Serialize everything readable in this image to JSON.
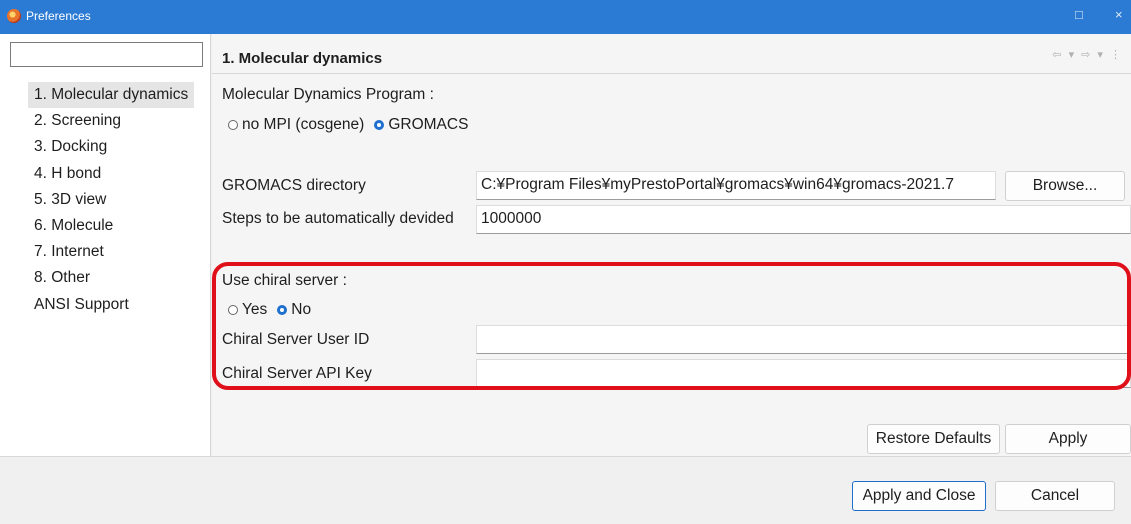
{
  "window": {
    "title": "Preferences",
    "controls": {
      "maximize": "□",
      "close": "×"
    }
  },
  "sidebar": {
    "filter_value": "",
    "items": [
      {
        "label": "1. Molecular dynamics",
        "selected": true
      },
      {
        "label": "2. Screening"
      },
      {
        "label": "3. Docking"
      },
      {
        "label": "4. H bond"
      },
      {
        "label": "5. 3D view"
      },
      {
        "label": "6. Molecule"
      },
      {
        "label": "7. Internet"
      },
      {
        "label": "8. Other"
      },
      {
        "label": "ANSI Support"
      }
    ]
  },
  "page": {
    "title": "1. Molecular dynamics",
    "nav_arrows": "⇦ ▾ ⇨ ▾ ⋮",
    "md_program": {
      "label": "Molecular Dynamics Program :",
      "options": [
        "no MPI (cosgene)",
        "GROMACS"
      ],
      "selected": "GROMACS"
    },
    "gromacs_dir": {
      "label": "GROMACS directory",
      "value": "C:¥Program Files¥myPrestoPortal¥gromacs¥win64¥gromacs-2021.7",
      "browse_label": "Browse..."
    },
    "steps": {
      "label": "Steps to be automatically devided",
      "value": "1000000"
    },
    "chiral": {
      "label": "Use chiral server :",
      "options": [
        "Yes",
        "No"
      ],
      "selected": "No",
      "user_id_label": "Chiral Server User ID",
      "user_id_value": "",
      "api_key_label": "Chiral Server API Key",
      "api_key_value": ""
    },
    "restore_label": "Restore Defaults",
    "apply_label": "Apply"
  },
  "footer": {
    "apply_close_label": "Apply and Close",
    "cancel_label": "Cancel"
  },
  "colors": {
    "titlebar": "#2b7bd4",
    "highlight": "#e0101b",
    "radio_selected": "#1f6fce"
  }
}
